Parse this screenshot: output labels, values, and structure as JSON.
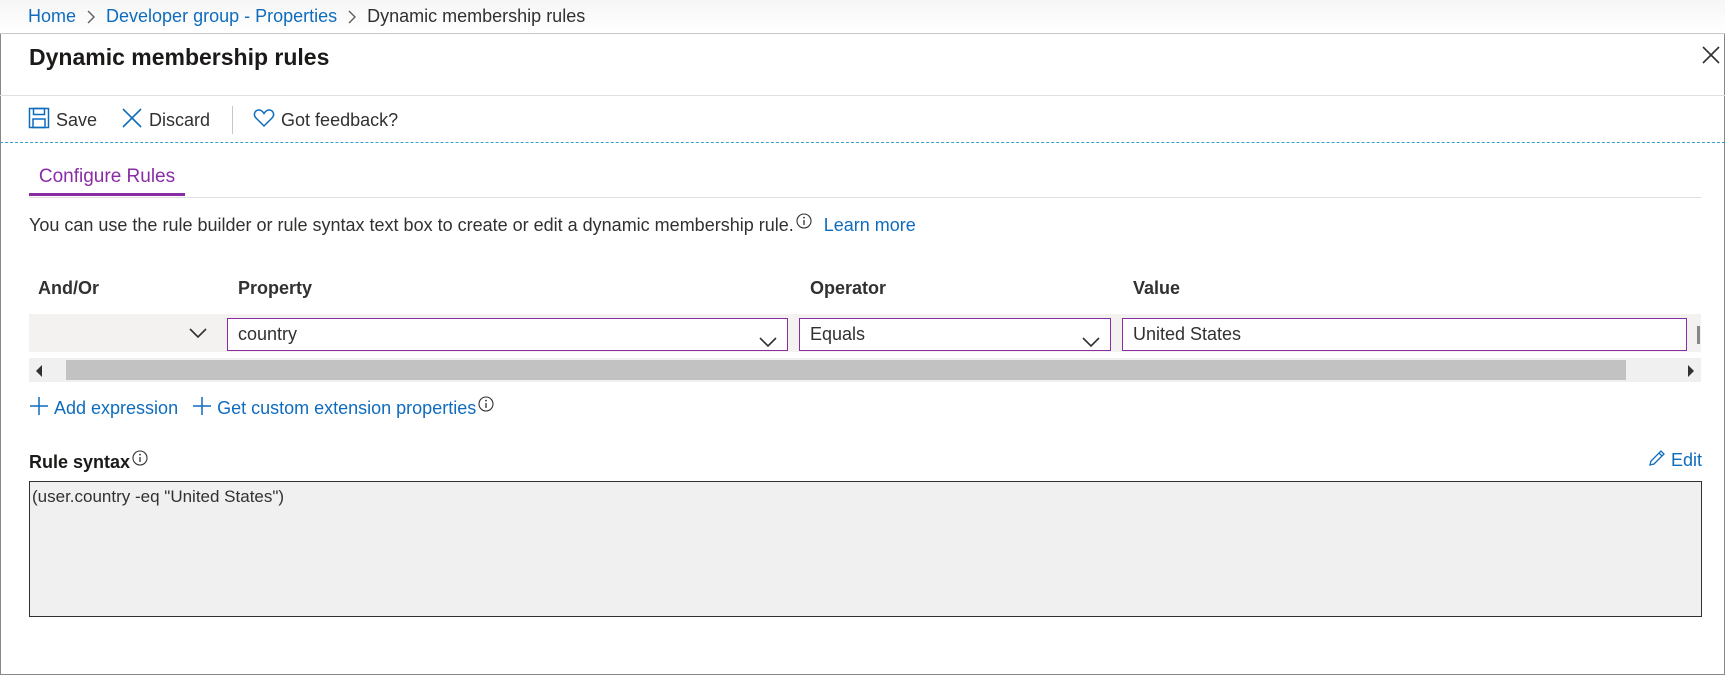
{
  "breadcrumb": {
    "home": "Home",
    "parent": "Developer group - Properties",
    "current": "Dynamic membership rules"
  },
  "page": {
    "title": "Dynamic membership rules"
  },
  "toolbar": {
    "save_label": "Save",
    "discard_label": "Discard",
    "feedback_label": "Got feedback?"
  },
  "tabs": [
    {
      "label": "Configure Rules",
      "active": true
    }
  ],
  "description": {
    "text": "You can use the rule builder or rule syntax text box to create or edit a dynamic membership rule.",
    "learn_more": "Learn more"
  },
  "rule_table": {
    "headers": {
      "and_or": "And/Or",
      "property": "Property",
      "operator": "Operator",
      "value": "Value"
    },
    "rows": [
      {
        "and_or": "",
        "property": "country",
        "operator": "Equals",
        "value": "United States"
      }
    ]
  },
  "actions": {
    "add_expression": "Add expression",
    "custom_extension": "Get custom extension properties"
  },
  "rule_syntax": {
    "label": "Rule syntax",
    "edit_label": "Edit",
    "value": "(user.country -eq \"United States\")"
  },
  "colors": {
    "accent_purple": "#8a2da5",
    "link_blue": "#0f6cbd",
    "text": "#323130"
  },
  "icons": [
    "chevron-right-icon",
    "close-icon",
    "save-icon",
    "discard-icon",
    "heart-icon",
    "info-icon",
    "chevron-down-icon",
    "plus-icon",
    "pencil-icon",
    "scroll-left-icon",
    "scroll-right-icon"
  ]
}
